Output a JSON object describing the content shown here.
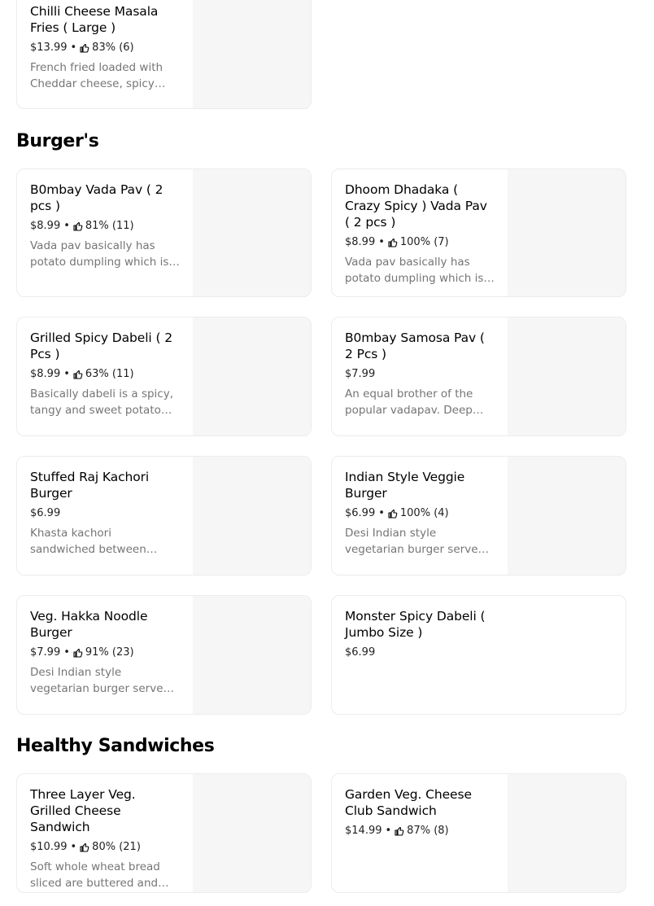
{
  "top_item": {
    "name": "Chilli Cheese Masala Fries ( Large )",
    "price": "$13.99",
    "rating": "83% (6)",
    "description": "French fried loaded with Cheddar cheese, spicy chilli masala"
  },
  "sections": [
    {
      "title": "Burger's",
      "items": [
        {
          "name": "B0mbay Vada Pav ( 2 pcs )",
          "price": "$8.99",
          "rating": "81% (11)",
          "description": "Vada pav basically has potato dumpling which is deep fried"
        },
        {
          "name": "Dhoom Dhadaka ( Crazy Spicy ) Vada Pav ( 2 pcs )",
          "price": "$8.99",
          "rating": "100% (7)",
          "description": "Vada pav basically has potato dumpling which is deep fried"
        },
        {
          "name": "Grilled Spicy Dabeli ( 2 Pcs )",
          "price": "$8.99",
          "rating": "63% (11)",
          "description": "Basically dabeli is a spicy, tangy and sweet potato mixture"
        },
        {
          "name": "B0mbay Samosa Pav ( 2 Pcs )",
          "price": "$7.99",
          "rating": "",
          "description": "An equal brother of the popular vadapav. Deep fried samosa"
        },
        {
          "name": "Stuffed Raj Kachori Burger",
          "price": "$6.99",
          "rating": "",
          "description": "Khasta kachori sandwiched between Burger bun and chutneys"
        },
        {
          "name": "Indian Style Veggie Burger",
          "price": "$6.99",
          "rating": "100% (4)",
          "description": "Desi Indian style vegetarian burger served with choice of sauce"
        },
        {
          "name": "Veg. Hakka Noodle Burger",
          "price": "$7.99",
          "rating": "91% (23)",
          "description": "Desi Indian style vegetarian burger served with choice of sauce"
        },
        {
          "name": "Monster Spicy Dabeli ( Jumbo Size )",
          "price": "$6.99",
          "rating": "",
          "description": ""
        }
      ]
    },
    {
      "title": "Healthy Sandwiches",
      "items": [
        {
          "name": "Three Layer Veg. Grilled Cheese Sandwich",
          "price": "$10.99",
          "rating": "80% (21)",
          "description": "Soft whole wheat bread sliced are buttered and grilled"
        },
        {
          "name": "Garden Veg. Cheese Club Sandwich",
          "price": "$14.99",
          "rating": "87% (8)",
          "description": ""
        }
      ]
    }
  ],
  "icons": {
    "rating": "thumbs-up-icon"
  },
  "colors": {
    "description": "#757575",
    "thumbnail_bg": "#f6f6f6",
    "card_border": "#ececec"
  }
}
